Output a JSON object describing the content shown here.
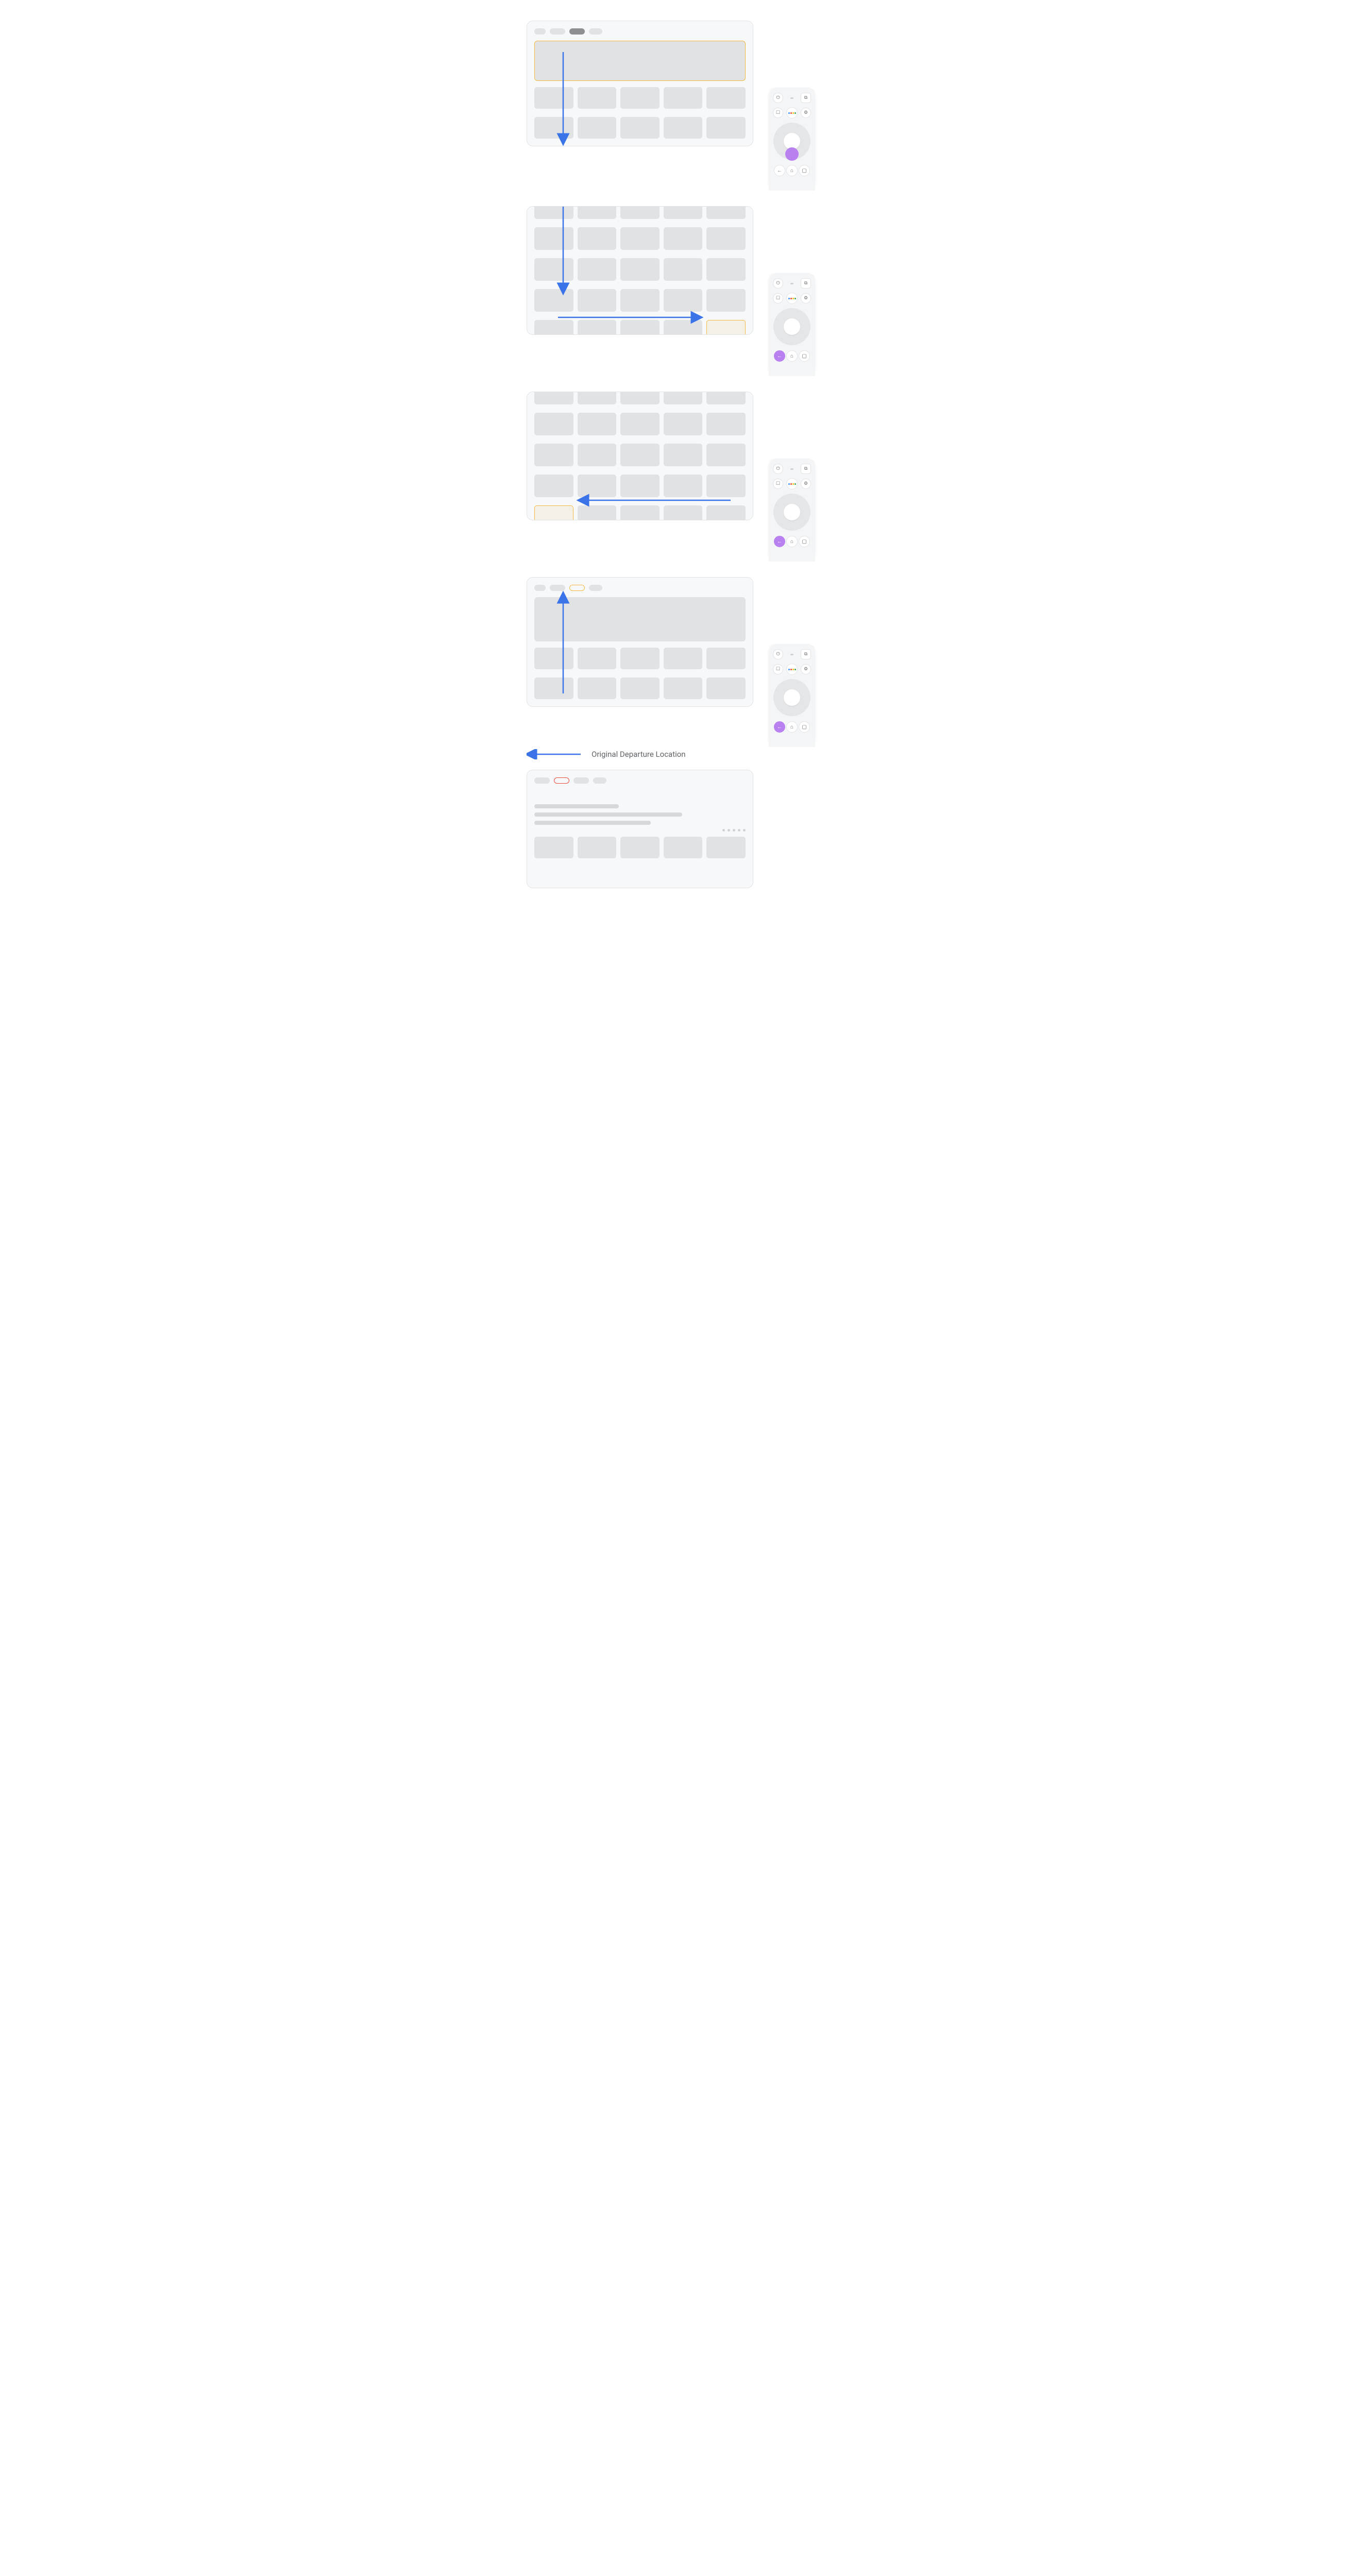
{
  "panels": {
    "p1": {
      "button_highlight": "dpad-down"
    },
    "p2": {
      "button_highlight": "back"
    },
    "p3": {
      "button_highlight": "back"
    },
    "p4": {
      "button_highlight": "back"
    }
  },
  "label": "Original Departure Location",
  "colors": {
    "arrow": "#3b73e8",
    "focus_yellow": "#f4b942",
    "focus_red": "#e74c3c",
    "highlight": "#b980f0"
  },
  "icons": {
    "power": "⏻",
    "input": "⧉",
    "bookmark": "☐",
    "settings": "⚙",
    "back": "←",
    "home": "⌂",
    "tv": "▢"
  }
}
